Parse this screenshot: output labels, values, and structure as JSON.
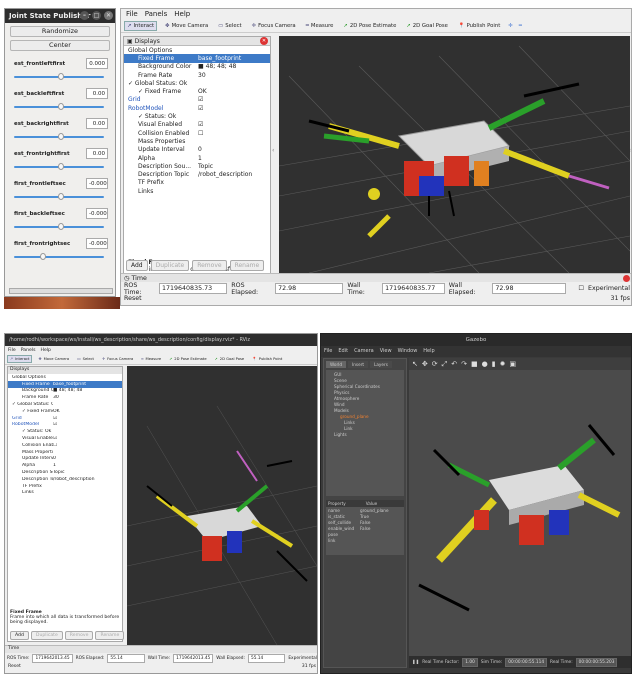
{
  "jsp": {
    "title": "Joint State Publisher",
    "randomize": "Randomize",
    "center": "Center",
    "joints": [
      {
        "name": "est_frontleftfirst",
        "value": "0.000",
        "pos": 0.5
      },
      {
        "name": "est_backleftfirst",
        "value": "0.00",
        "pos": 0.5
      },
      {
        "name": "est_backrightfirst",
        "value": "0.00",
        "pos": 0.5
      },
      {
        "name": "est_frontrightfirst",
        "value": "0.00",
        "pos": 0.5
      },
      {
        "name": "first_frontleftsec",
        "value": "-0.000",
        "pos": 0.5
      },
      {
        "name": "first_backleftsec",
        "value": "-0.000",
        "pos": 0.5
      },
      {
        "name": "first_frontrightsec",
        "value": "-0.000",
        "pos": 0.3
      }
    ]
  },
  "rviz": {
    "menu": [
      "File",
      "Panels",
      "Help"
    ],
    "tools": [
      {
        "icon": "interact-icon",
        "label": "Interact"
      },
      {
        "icon": "move-camera-icon",
        "label": "Move Camera"
      },
      {
        "icon": "select-icon",
        "label": "Select"
      },
      {
        "icon": "focus-camera-icon",
        "label": "Focus Camera"
      },
      {
        "icon": "measure-icon",
        "label": "Measure"
      },
      {
        "icon": "pose-estimate-icon",
        "label": "2D Pose Estimate"
      },
      {
        "icon": "goal-pose-icon",
        "label": "2D Goal Pose"
      },
      {
        "icon": "publish-point-icon",
        "label": "Publish Point"
      }
    ],
    "displays_title": "Displays",
    "tree": [
      {
        "k": "Global Options",
        "v": "",
        "d": 0,
        "c": "#"
      },
      {
        "k": "Fixed Frame",
        "v": "base_footprint",
        "d": 1,
        "sel": true
      },
      {
        "k": "Background Color",
        "v": "■ 48; 48; 48",
        "d": 1
      },
      {
        "k": "Frame Rate",
        "v": "30",
        "d": 1
      },
      {
        "k": "✓ Global Status: Ok",
        "v": "",
        "d": 0
      },
      {
        "k": "✓ Fixed Frame",
        "v": "OK",
        "d": 1
      },
      {
        "k": "Grid",
        "v": "☑",
        "d": 0,
        "blue": true
      },
      {
        "k": "RobotModel",
        "v": "☑",
        "d": 0,
        "blue": true
      },
      {
        "k": "✓ Status: Ok",
        "v": "",
        "d": 1
      },
      {
        "k": "Visual Enabled",
        "v": "☑",
        "d": 1
      },
      {
        "k": "Collision Enabled",
        "v": "☐",
        "d": 1
      },
      {
        "k": "Mass Properties",
        "v": "",
        "d": 1
      },
      {
        "k": "Update Interval",
        "v": "0",
        "d": 1
      },
      {
        "k": "Alpha",
        "v": "1",
        "d": 1
      },
      {
        "k": "Description Sou...",
        "v": "Topic",
        "d": 1
      },
      {
        "k": "Description Topic",
        "v": "/robot_description",
        "d": 1
      },
      {
        "k": "TF Prefix",
        "v": "",
        "d": 1
      },
      {
        "k": "Links",
        "v": "",
        "d": 1
      }
    ],
    "desc_title": "Fixed Frame",
    "desc_text": "Frame into which all data is transformed before being displayed.",
    "buttons": [
      "Add",
      "Duplicate",
      "Remove",
      "Rename"
    ],
    "time_title": "Time",
    "ros_time_label": "ROS Time:",
    "ros_time": "1719640835.73",
    "ros_elapsed_label": "ROS Elapsed:",
    "ros_elapsed": "72.98",
    "wall_time_label": "Wall Time:",
    "wall_time": "1719640835.77",
    "wall_elapsed_label": "Wall Elapsed:",
    "wall_elapsed": "72.98",
    "experimental": "Experimental",
    "reset": "Reset",
    "fps": "31 fps"
  },
  "brviz": {
    "title": "/home/rodhi/workspace/ws/install/ws_description/share/ws_description/config/display.rviz* - RViz",
    "tree_extra": "Mass Properties",
    "ros_time": "1719642013.45",
    "ros_elapsed": "55.14",
    "wall_time": "1719642013.45",
    "wall_elapsed": "55.14",
    "fps": "31 fps"
  },
  "gazebo": {
    "title": "Gazebo",
    "menu": [
      "File",
      "Edit",
      "Camera",
      "View",
      "Window",
      "Help"
    ],
    "tabs": [
      "World",
      "Insert",
      "Layers"
    ],
    "tree": [
      "GUI",
      "Scene",
      "Spherical Coordinates",
      "Physics",
      "Atmosphere",
      "Wind",
      "Models",
      "ground_plane",
      "Links",
      "Link",
      "Lights"
    ],
    "prop_head": [
      "Property",
      "Value"
    ],
    "props": [
      [
        "name",
        "ground_plane"
      ],
      [
        "is_static",
        "True"
      ],
      [
        "self_collide",
        "False"
      ],
      [
        "enable_wind",
        "False"
      ],
      [
        "pose",
        ""
      ],
      [
        "link",
        ""
      ]
    ],
    "status": [
      {
        "l": "Real Time Factor:",
        "v": "1.00"
      },
      {
        "l": "Sim Time:",
        "v": "00:00:00:55.114"
      },
      {
        "l": "Real Time:",
        "v": "00:00:00:55.203"
      }
    ]
  }
}
